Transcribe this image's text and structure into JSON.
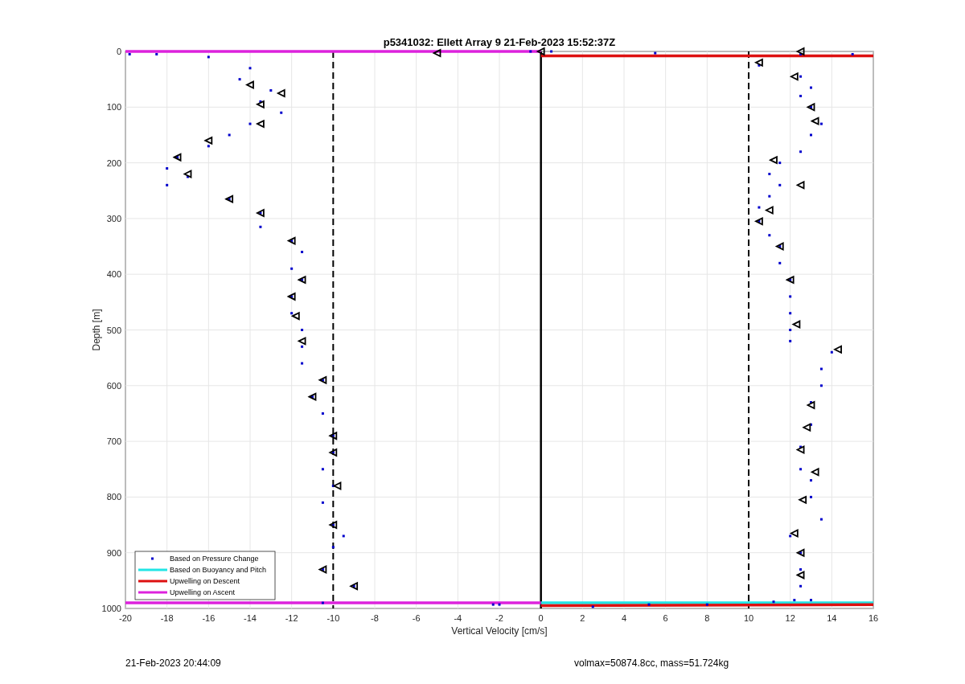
{
  "figure": {
    "chart_data": {
      "type": "scatter",
      "title": "p5341032: Ellett Array 9 21-Feb-2023 15:52:37Z",
      "xlabel": "Vertical Velocity [cm/s]",
      "ylabel": "Depth [m]",
      "xlim": [
        -20,
        16
      ],
      "ylim": [
        1000,
        0
      ],
      "xticks": [
        -20,
        -18,
        -16,
        -14,
        -12,
        -10,
        -8,
        -6,
        -4,
        -2,
        0,
        2,
        4,
        6,
        8,
        10,
        12,
        14,
        16
      ],
      "yticks": [
        0,
        100,
        200,
        300,
        400,
        500,
        600,
        700,
        800,
        900,
        1000
      ],
      "series": [
        {
          "name": "Based on Pressure Change",
          "type": "scatter",
          "marker": "square",
          "color": "#0000cc",
          "x": [
            -19.8,
            -18.5,
            -16,
            -0.5,
            0.5,
            5.5,
            15,
            -14,
            -14.5,
            -13,
            -13.5,
            -12.5,
            -14,
            -15,
            -16,
            -17.5,
            -18,
            -17,
            -18,
            -15,
            -13.5,
            -13.5,
            -12,
            -11.5,
            -12,
            -11.5,
            -12,
            -12,
            -11.5,
            -11.5,
            -11.5,
            -10.5,
            -11,
            -10.5,
            -10,
            -10,
            -10.5,
            -10,
            -10.5,
            -10,
            -9.5,
            -10,
            -10.5,
            -9,
            -10.5,
            12.5,
            10.5,
            12.5,
            13,
            12.5,
            13,
            13.5,
            13,
            12.5,
            11.5,
            11,
            11.5,
            11,
            10.5,
            10.5,
            11,
            11.5,
            11.5,
            12,
            12,
            12,
            12,
            12,
            14,
            13.5,
            13.5,
            13,
            13,
            12.5,
            12.5,
            13,
            13,
            13.5,
            12,
            12.5,
            12.5,
            12.5,
            13,
            -2.3,
            -2,
            2.5,
            5.2,
            8,
            11.2,
            12.2
          ],
          "values": [
            5,
            5,
            10,
            0,
            0,
            3,
            5,
            30,
            50,
            70,
            90,
            110,
            130,
            150,
            170,
            190,
            210,
            225,
            240,
            265,
            290,
            315,
            340,
            360,
            390,
            410,
            440,
            470,
            500,
            530,
            560,
            590,
            620,
            650,
            690,
            720,
            750,
            780,
            810,
            850,
            870,
            890,
            930,
            960,
            990,
            5,
            25,
            45,
            65,
            80,
            100,
            130,
            150,
            180,
            200,
            220,
            240,
            260,
            280,
            305,
            330,
            350,
            380,
            410,
            440,
            470,
            500,
            520,
            540,
            570,
            600,
            630,
            670,
            710,
            750,
            770,
            800,
            840,
            870,
            900,
            930,
            960,
            985,
            993,
            993,
            997,
            993,
            993,
            988,
            985
          ]
        },
        {
          "type": "scatter",
          "marker": "triangle",
          "color": "#000000",
          "x": [
            -5,
            0,
            -14,
            -12.5,
            -13.5,
            -13.5,
            -16,
            -17.5,
            -17,
            -15,
            -13.5,
            -12,
            -11.5,
            -12,
            -11.8,
            -11.5,
            -10.5,
            -11,
            -10,
            -10,
            -9.8,
            -10,
            -10.5,
            -9,
            12.5,
            10.5,
            12.2,
            13,
            13.2,
            11.2,
            12.5,
            11,
            10.5,
            11.5,
            12,
            12.3,
            14.3,
            13,
            12.8,
            12.5,
            13.2,
            12.6,
            12.2,
            12.5,
            12.5
          ],
          "values": [
            3,
            0,
            60,
            75,
            95,
            130,
            160,
            190,
            220,
            265,
            290,
            340,
            410,
            440,
            475,
            520,
            590,
            620,
            690,
            720,
            780,
            850,
            930,
            960,
            0,
            20,
            45,
            100,
            125,
            195,
            240,
            285,
            305,
            350,
            410,
            490,
            535,
            635,
            675,
            715,
            755,
            805,
            865,
            900,
            940
          ]
        },
        {
          "type": "line",
          "color": "#000000",
          "x": [
            0,
            0
          ],
          "values": [
            0,
            1000
          ]
        },
        {
          "name": "Based on Buoyancy and Pitch",
          "type": "line",
          "color": "#22e5e5",
          "x": [
            0,
            16
          ],
          "values": [
            990,
            990
          ]
        },
        {
          "name": "Upwelling on Descent",
          "type": "line",
          "color": "#dd1111",
          "x": [
            0,
            16
          ],
          "values": [
            8,
            8
          ]
        },
        {
          "type": "line",
          "color": "#dd1111",
          "x": [
            0,
            16
          ],
          "values": [
            995,
            993
          ]
        },
        {
          "name": "Upwelling on Ascent",
          "type": "line",
          "color": "#dd22dd",
          "x": [
            -20,
            0
          ],
          "values": [
            0,
            0
          ]
        },
        {
          "type": "line",
          "color": "#dd22dd",
          "x": [
            -20,
            0
          ],
          "values": [
            990,
            990
          ]
        }
      ],
      "ref_lines": [
        {
          "axis": "x",
          "value": -10
        },
        {
          "axis": "x",
          "value": 10
        }
      ],
      "grid": true,
      "legend": true
    }
  },
  "footer": {
    "timestamp": "21-Feb-2023 20:44:09",
    "parameters": "volmax=50874.8cc, mass=51.724kg"
  }
}
